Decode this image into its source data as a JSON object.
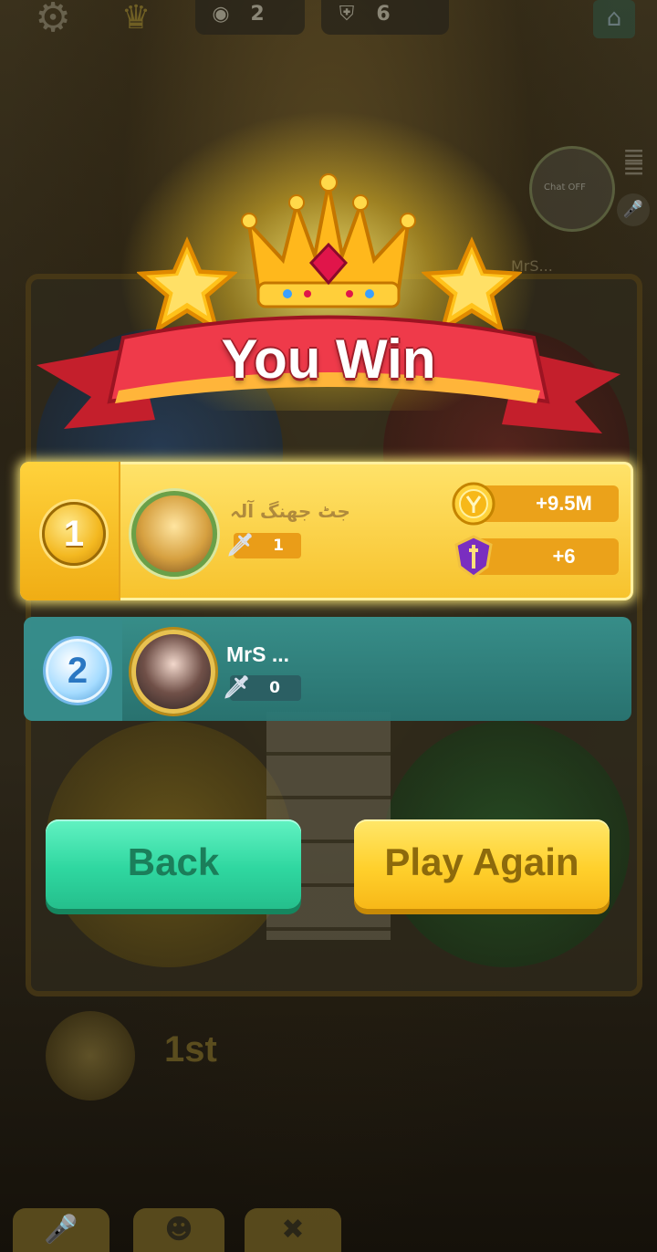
{
  "topbar": {
    "watch_count": "2",
    "shield_count": "6"
  },
  "chat": {
    "status": "Chat OFF",
    "faded_name": "MrS..."
  },
  "result": {
    "title": "You Win",
    "players": [
      {
        "rank": "1",
        "name": "جٹ جھنگ آلہ",
        "kills": "1",
        "coins_reward": "+9.5M",
        "trophy_reward": "+6"
      },
      {
        "rank": "2",
        "name": "MrS ...",
        "kills": "0"
      }
    ]
  },
  "buttons": {
    "back": "Back",
    "play_again": "Play Again"
  },
  "bottom": {
    "place": "1st"
  },
  "colors": {
    "gold": "#f7c22c",
    "teal": "#389692",
    "ribbon_red": "#e63444",
    "back_green": "#2fd7a0",
    "play_yellow": "#ffd02c"
  }
}
